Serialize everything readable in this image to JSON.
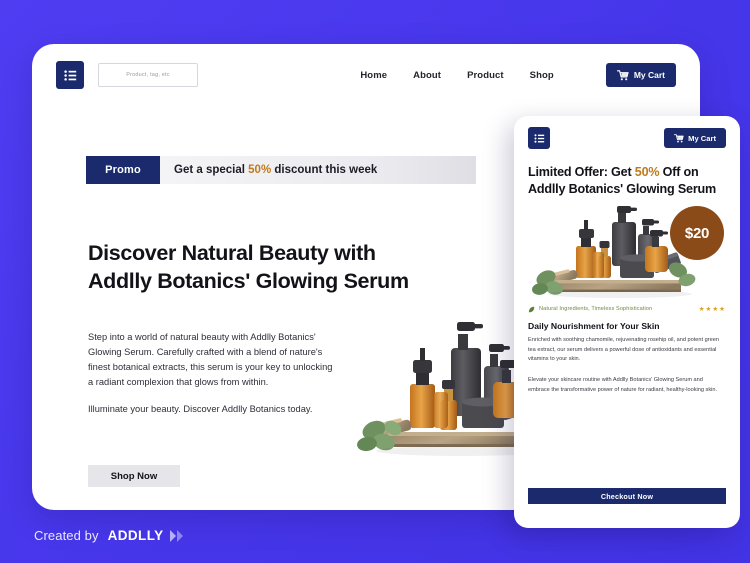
{
  "theme": {
    "background": "#4636EA",
    "navy": "#1A2A6C",
    "accent_gold": "#C07A1E",
    "badge_brown": "#8A4B18",
    "card_white": "#FFFFFF",
    "star_gold": "#D9A21B",
    "tagline_green": "#6E8A3F"
  },
  "desktop": {
    "nav": {
      "menu_icon": "hamburger-list-icon",
      "search_placeholder": "Product, tag, etc",
      "search_value": "",
      "links": [
        {
          "label": "Home"
        },
        {
          "label": "About"
        },
        {
          "label": "Product"
        },
        {
          "label": "Shop"
        }
      ],
      "cart": {
        "icon": "shopping-cart-icon",
        "label": "My Cart"
      }
    },
    "promo": {
      "tag": "Promo",
      "text_before": "Get a special ",
      "percent": "50%",
      "text_after": " discount this week"
    },
    "hero": {
      "title": "Discover Natural Beauty with Addlly Botanics' Glowing Serum",
      "paragraph_1": "Step into a world of natural beauty with Addlly Botanics' Glowing Serum. Carefully crafted with a blend of nature's finest botanical extracts, this serum is your key to unlocking a radiant complexion that glows from within.",
      "paragraph_2": "Illuminate your beauty. Discover Addlly Botanics today.",
      "cta_label": "Shop Now",
      "photo_alt": "amber-serum-bottles-on-wooden-tray-product-photo"
    }
  },
  "mobile": {
    "nav": {
      "menu_icon": "hamburger-list-icon",
      "cart": {
        "icon": "shopping-cart-icon",
        "label": "My Cart"
      }
    },
    "title_before": "Limited Offer: Get ",
    "title_percent": "50%",
    "title_after": " Off on Addlly Botanics' Glowing Serum",
    "price_badge": "$20",
    "photo_alt": "amber-serum-bottles-on-wooden-tray-product-photo",
    "tagline": "Natural Ingredients, Timeless Sophistication",
    "tagline_icon": "leaf-icon",
    "stars": "★★★★",
    "star_count": 4,
    "subheading": "Daily Nourishment for Your Skin",
    "body_1": "Enriched with soothing chamomile, rejuvenating rosehip oil, and potent green tea extract, our serum delivers a powerful dose of antioxidants and essential vitamins to your skin.",
    "body_2": "Elevate your skincare routine with Addlly Botanics' Glowing Serum and embrace the transformative power of nature for radiant, healthy-looking skin.",
    "cta_label": "Checkout Now"
  },
  "footer": {
    "created_by": "Created by",
    "brand": "ADDLLY",
    "chevron_icon": "double-chevron-right-icon"
  }
}
